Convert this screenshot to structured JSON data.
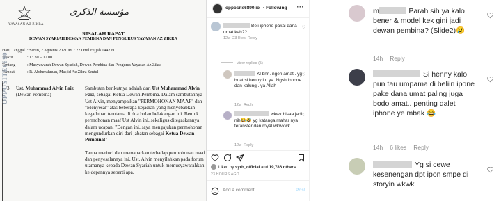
{
  "document": {
    "foundation_name": "YAYASAN AZ-ZIKRA",
    "arabic_logo": "مؤسسة الذكرى",
    "title": "RISALAH RAPAT",
    "subtitle": "DEWAN SYARIAH DEWAN PEMBINA DAN PENGURUS YAYASAN AZ ZIKRA",
    "meta": [
      {
        "key": "Hari, Tanggal",
        "value": ": Senin, 2 Agustus 2021 M. / 22 Dzul Hijjah 1442 H."
      },
      {
        "key": "Waktu",
        "value": ": 13.30 – 17.00"
      },
      {
        "key": "Tentang",
        "value": ": Musyawarah Dewan Syariah, Dewan Pembina dan Pengurus Yayasan Az Zikra"
      },
      {
        "key": "Tempat",
        "value": ": R. Abdurrahman, Masjid Az Zikra Sentul"
      }
    ],
    "row_number": "3",
    "speaker_name": "Ust. Muhammad Alvin Faiz",
    "speaker_role": "(Dewan Pembina)",
    "para1_a": "Sambutan berikutnya adalah dari ",
    "para1_b": "Ust Muhammad Alvin Faiz",
    "para1_c": ", sebagai Ketua Dewan Pembina. Dalam sambutannya Ust Alvin, menyampaikan \"PERMOHONAN MAAF\" dan \"Menyesal\" atas beberapa kejadian yang menyebabkan kegaduhan terutama di dua bulan belakangan ini. Bentuk permohonan maaf Ust Alvin ini, sekaligus ditegaskannya dalam ucapan, \"Dengan ini, saya mengajukan permohonan mengundurkan diri dari jabatan sebagai ",
    "para1_d": "Ketua Dewan Pembina!",
    "para1_e": "\"",
    "para2": "Tanpa merinci dan memaparkan terhadap permohonan maaf dan penyesalannya ini, Ust. Alvin menyilahkan pada forum utamanya kepada Dewan Syariah untuk memusyawarahkan ke depannya seperti apa.",
    "watermark": "OPPOSITE6890"
  },
  "post": {
    "username": "opposite6890.io",
    "following": "• Following",
    "more_icon": "ellipsis-icon",
    "comments": [
      {
        "text": "Beli iphone pakai dana umat kah??",
        "time": "12w",
        "likes": "23 likes",
        "reply": "Reply"
      },
      {
        "text": "Kl bnr.. ngeri amat.. yg buat si henny itu ya. Ngsh iphone dan kalung.. ya Allah",
        "time": "12w",
        "likes": "",
        "reply": "Reply"
      },
      {
        "text": "wkwk bisaa jadi nih😂🤣 yg katanga mahar nya teransfer dan royal wkwkwk",
        "time": "12w",
        "likes": "",
        "reply": "Reply"
      }
    ],
    "view_replies": "View replies (5)",
    "liked_by_prefix": "Liked by ",
    "liked_by_user": "syrb_official",
    "liked_by_and": " and ",
    "liked_by_count": "19,786 others",
    "time_ago": "23 HOURS AGO",
    "add_comment_placeholder": "Add a comment...",
    "post_button": "Post"
  },
  "replies": [
    {
      "user": "m",
      "text": "Parah sih ya kalo bener & model kek gini jadi dewan pembina? (Slide2)😢",
      "time": "14h",
      "likes": "",
      "reply": "Reply",
      "avatar_color": "#d9c9cf"
    },
    {
      "user": "",
      "text": "Si henny kalo pun tau umpama di beliin ipone pake dana umat paling juga bodo amat.. penting dalet iphone ye mbak 😂",
      "time": "14h",
      "likes": "6 likes",
      "reply": "Reply",
      "avatar_color": "#3d3f4a"
    },
    {
      "user": "",
      "text": "Yg si cewe kesenengan dpt ipon smpe di storyin wkwk",
      "time": "",
      "likes": "",
      "reply": "",
      "avatar_color": "#c8cdb5"
    }
  ],
  "colors": {
    "muted": "#8e8e8e",
    "link": "#b2dffc",
    "redaction": "#d4d4d4"
  }
}
